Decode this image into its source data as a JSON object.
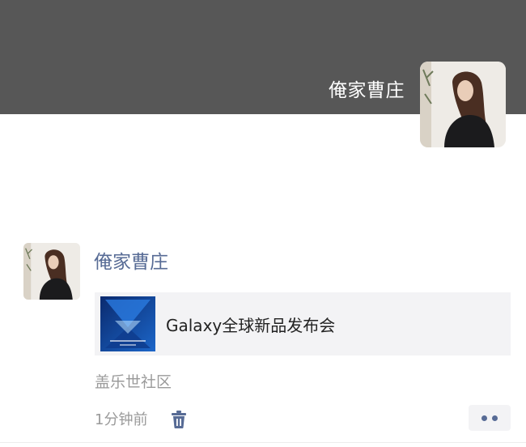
{
  "cover": {
    "username": "俺家曹庄",
    "background_color": "#575757",
    "avatar_icon": "profile-photo-woman"
  },
  "post": {
    "author": "俺家曹庄",
    "author_color": "#576b95",
    "avatar_icon": "profile-photo-woman",
    "link": {
      "title": "Galaxy全球新品发布会",
      "thumbnail_icon": "event-thumbnail-blue"
    },
    "location": "盖乐世社区",
    "time": "1分钟前",
    "delete_icon": "trash-icon",
    "more_icon": "more-dots-icon"
  }
}
